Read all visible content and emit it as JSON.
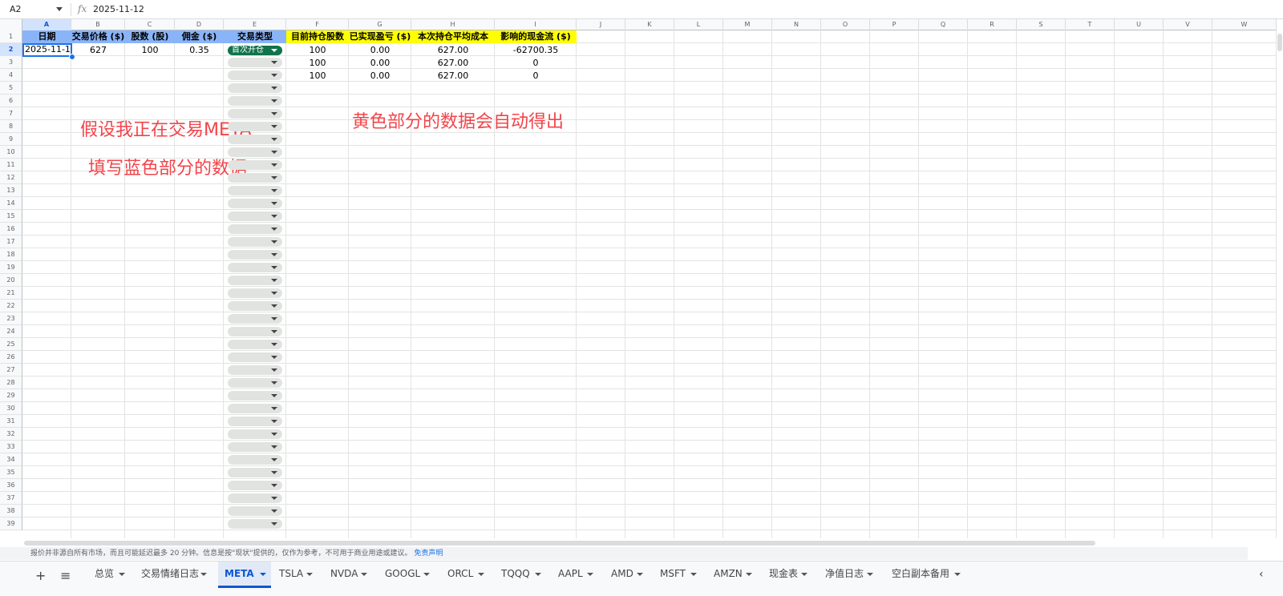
{
  "formula_bar": {
    "cell_ref": "A2",
    "fx_label": "fx",
    "content": "2025-11-12"
  },
  "columns": [
    "A",
    "B",
    "C",
    "D",
    "E",
    "F",
    "G",
    "H",
    "I",
    "J",
    "K",
    "L",
    "M",
    "N",
    "O",
    "P",
    "Q",
    "R",
    "S",
    "T",
    "U",
    "V",
    "W"
  ],
  "rows": [
    "1",
    "2",
    "3",
    "4",
    "5",
    "6",
    "7",
    "8",
    "9",
    "10",
    "11",
    "12",
    "13",
    "14",
    "15",
    "16",
    "17",
    "18",
    "19",
    "20",
    "21",
    "22",
    "23",
    "24",
    "25",
    "26",
    "27",
    "28",
    "29",
    "30",
    "31",
    "32",
    "33",
    "34",
    "35",
    "36",
    "37",
    "38",
    "39"
  ],
  "header_row": [
    "日期",
    "交易价格 ($)",
    "股数 (股)",
    "佣金 ($)",
    "交易类型",
    "目前持仓股数",
    "已实现盈亏 ($)",
    "本次持仓平均成本",
    "影响的现金流 ($)"
  ],
  "data_rows": [
    [
      "2025-11-12",
      "627",
      "100",
      "0.35",
      "首次开仓",
      "100",
      "0.00",
      "627.00",
      "-62700.35"
    ],
    [
      "",
      "",
      "",
      "",
      "",
      "100",
      "0.00",
      "627.00",
      "0"
    ],
    [
      "",
      "",
      "",
      "",
      "",
      "100",
      "0.00",
      "627.00",
      "0"
    ]
  ],
  "annotations": {
    "line1": "假设我正在交易META",
    "line2": "填写蓝色部分的数据",
    "line3": "黄色部分的数据会自动得出"
  },
  "notice": {
    "text": "报价并非源自所有市场，而且可能延迟最多 20 分钟。信息是按\"现状\"提供的，仅作为参考，不可用于商业用途或建议。",
    "link": "免责声明"
  },
  "tabbar": {
    "add_icon": "+",
    "menu_icon": "≡",
    "nav_icon": "‹",
    "tabs": [
      "总览",
      "交易情绪日志",
      "META",
      "TSLA",
      "NVDA",
      "GOOGL",
      "ORCL",
      "TQQQ",
      "AAPL",
      "AMD",
      "MSFT",
      "AMZN",
      "现金表",
      "净值日志",
      "空白副本备用"
    ],
    "active_tab": "META"
  },
  "colors": {
    "blue_header": "#8ab4f8",
    "yellow_header": "#ffff00",
    "chip_green": "#11734b",
    "annotation_red": "#f2444a",
    "selection_blue": "#1a73e8"
  }
}
